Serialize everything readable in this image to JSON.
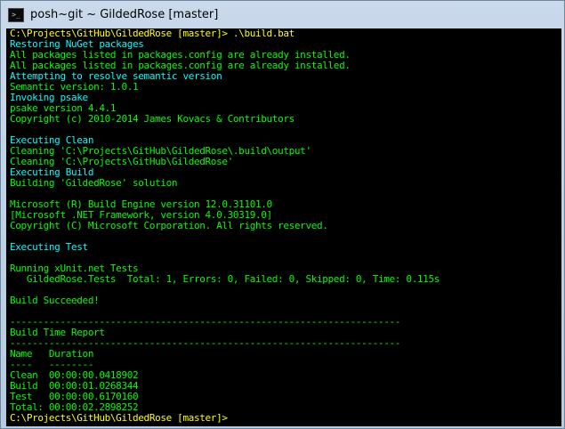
{
  "window": {
    "title": "posh~git ~ GildedRose [master]",
    "icon": "powershell-console-icon"
  },
  "console": {
    "lines": [
      {
        "text": "C:\\Projects\\GitHub\\GildedRose [master]> .\\build.bat",
        "color": "yellow"
      },
      {
        "text": "Restoring NuGet packages",
        "color": "cyan"
      },
      {
        "text": "All packages listed in packages.config are already installed.",
        "color": "green"
      },
      {
        "text": "All packages listed in packages.config are already installed.",
        "color": "green"
      },
      {
        "text": "Attempting to resolve semantic version",
        "color": "cyan"
      },
      {
        "text": "Semantic version: 1.0.1",
        "color": "green"
      },
      {
        "text": "Invoking psake",
        "color": "cyan"
      },
      {
        "text": "psake version 4.4.1",
        "color": "green"
      },
      {
        "text": "Copyright (c) 2010-2014 James Kovacs & Contributors",
        "color": "green"
      },
      {
        "text": "",
        "color": "green"
      },
      {
        "text": "Executing Clean",
        "color": "cyan"
      },
      {
        "text": "Cleaning 'C:\\Projects\\GitHub\\GildedRose\\.build\\output'",
        "color": "green"
      },
      {
        "text": "Cleaning 'C:\\Projects\\GitHub\\GildedRose'",
        "color": "green"
      },
      {
        "text": "Executing Build",
        "color": "cyan"
      },
      {
        "text": "Building 'GildedRose' solution",
        "color": "green"
      },
      {
        "text": "",
        "color": "green"
      },
      {
        "text": "Microsoft (R) Build Engine version 12.0.31101.0",
        "color": "green"
      },
      {
        "text": "[Microsoft .NET Framework, version 4.0.30319.0]",
        "color": "green"
      },
      {
        "text": "Copyright (C) Microsoft Corporation. All rights reserved.",
        "color": "green"
      },
      {
        "text": "",
        "color": "green"
      },
      {
        "text": "Executing Test",
        "color": "cyan"
      },
      {
        "text": "",
        "color": "green"
      },
      {
        "text": "Running xUnit.net Tests",
        "color": "green"
      },
      {
        "text": "   GildedRose.Tests  Total: 1, Errors: 0, Failed: 0, Skipped: 0, Time: 0.115s",
        "color": "green"
      },
      {
        "text": "",
        "color": "green"
      },
      {
        "text": "Build Succeeded!",
        "color": "green"
      },
      {
        "text": "",
        "color": "green"
      },
      {
        "text": "----------------------------------------------------------------------",
        "color": "green"
      },
      {
        "text": "Build Time Report",
        "color": "green"
      },
      {
        "text": "----------------------------------------------------------------------",
        "color": "green"
      },
      {
        "text": "Name   Duration",
        "color": "green"
      },
      {
        "text": "----   --------",
        "color": "green"
      },
      {
        "text": "Clean  00:00:00.0418902",
        "color": "green"
      },
      {
        "text": "Build  00:00:01.0268344",
        "color": "green"
      },
      {
        "text": "Test   00:00:00.6170160",
        "color": "green"
      },
      {
        "text": "Total: 00:00:02.2898252",
        "color": "green"
      },
      {
        "text": "C:\\Projects\\GitHub\\GildedRose [master]>",
        "color": "yellow"
      }
    ]
  }
}
